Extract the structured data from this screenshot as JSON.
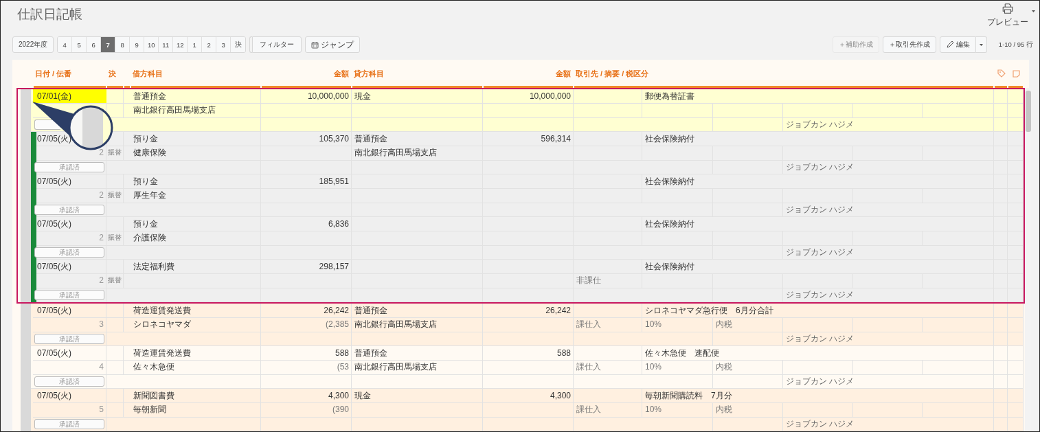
{
  "title": "仕訳日記帳",
  "preview": {
    "label": "プレビュー"
  },
  "toolbar": {
    "fiscal_year": "2022年度",
    "months": [
      {
        "label": "4",
        "selected": false
      },
      {
        "label": "5",
        "selected": false
      },
      {
        "label": "6",
        "selected": false
      },
      {
        "label": "7",
        "selected": true
      },
      {
        "label": "8",
        "selected": false
      },
      {
        "label": "9",
        "selected": false
      },
      {
        "label": "10",
        "selected": false
      },
      {
        "label": "11",
        "selected": false
      },
      {
        "label": "12",
        "selected": false
      },
      {
        "label": "1",
        "selected": false
      },
      {
        "label": "2",
        "selected": false
      },
      {
        "label": "3",
        "selected": false
      },
      {
        "label": "決",
        "selected": false
      }
    ],
    "filter": "フィルター",
    "jump": "ジャンプ",
    "actions": [
      {
        "label": "＋補助作成",
        "disabled": true
      },
      {
        "label": "＋取引先作成",
        "disabled": false
      }
    ],
    "edit": "編集",
    "row_count": "1-10 / 95 行"
  },
  "table": {
    "columns": [
      "日付 / 伝番",
      "決",
      "借方科目",
      "金額",
      "貸方科目",
      "金額",
      "取引先 / 摘要 / 税区分"
    ],
    "entries": [
      {
        "date": "07/01(金)",
        "selected": true,
        "marked": false,
        "boxed": true,
        "debit": {
          "account": "普通預金",
          "amount": "10,000,000",
          "sub": "南北銀行高田馬場支店"
        },
        "credit": {
          "account": "現金",
          "amount": "10,000,000"
        },
        "description": "郵便為替証書",
        "user": "ジョブカン ハジメ"
      },
      {
        "date": "07/05(火)",
        "number": "2",
        "kind_label": "振替",
        "approval": "承認済",
        "selected": false,
        "marked": true,
        "boxed": true,
        "debit": {
          "account": "預り金",
          "amount": "105,370",
          "sub": "健康保険"
        },
        "credit": {
          "account": "普通預金",
          "amount": "596,314",
          "sub": "南北銀行高田馬場支店"
        },
        "description": "社会保険納付",
        "user": "ジョブカン ハジメ"
      },
      {
        "date": "07/05(火)",
        "number": "2",
        "kind_label": "振替",
        "approval": "承認済",
        "selected": false,
        "marked": true,
        "boxed": true,
        "debit": {
          "account": "預り金",
          "amount": "185,951",
          "sub": "厚生年金"
        },
        "description": "社会保険納付",
        "user": "ジョブカン ハジメ"
      },
      {
        "date": "07/05(火)",
        "number": "2",
        "kind_label": "振替",
        "approval": "承認済",
        "selected": false,
        "marked": true,
        "boxed": true,
        "debit": {
          "account": "預り金",
          "amount": "6,836",
          "sub": "介護保険"
        },
        "description": "社会保険納付",
        "user": "ジョブカン ハジメ"
      },
      {
        "date": "07/05(火)",
        "number": "2",
        "kind_label": "振替",
        "approval": "承認済",
        "selected": false,
        "marked": true,
        "boxed": true,
        "debit": {
          "account": "法定福利費",
          "amount": "298,157"
        },
        "description": "社会保険納付",
        "tax_class": "非課仕",
        "user": "ジョブカン ハジメ"
      },
      {
        "date": "07/05(火)",
        "number": "3",
        "approval": "承認済",
        "selected": false,
        "marked": false,
        "boxed": false,
        "debit": {
          "account": "荷造運賃発送費",
          "amount": "26,242",
          "sub": "シロネコヤマダ",
          "tax": "(2,385"
        },
        "credit": {
          "account": "普通預金",
          "amount": "26,242",
          "sub": "南北銀行高田馬場支店"
        },
        "description": "シロネコヤマダ急行便　6月分合計",
        "tax_class": "課仕入",
        "tax_rate": "10%",
        "tax_type": "内税",
        "user": "ジョブカン ハジメ"
      },
      {
        "date": "07/05(火)",
        "number": "4",
        "approval": "承認済",
        "selected": false,
        "marked": false,
        "boxed": false,
        "debit": {
          "account": "荷造運賃発送費",
          "amount": "588",
          "sub": "佐々木急便",
          "tax": "(53"
        },
        "credit": {
          "account": "普通預金",
          "amount": "588",
          "sub": "南北銀行高田馬場支店"
        },
        "description": "佐々木急便　速配便",
        "tax_class": "課仕入",
        "tax_rate": "10%",
        "tax_type": "内税",
        "user": "ジョブカン ハジメ"
      },
      {
        "date": "07/05(火)",
        "number": "5",
        "approval": "承認済",
        "selected": false,
        "marked": false,
        "boxed": false,
        "debit": {
          "account": "新聞図書費",
          "amount": "4,300",
          "sub": "毎朝新聞",
          "tax": "(390"
        },
        "credit": {
          "account": "現金",
          "amount": "4,300"
        },
        "description": "毎朝新聞購読料　7月分",
        "tax_class": "課仕入",
        "tax_rate": "10%",
        "tax_type": "内税",
        "user": "ジョブカン ハジメ"
      }
    ]
  }
}
